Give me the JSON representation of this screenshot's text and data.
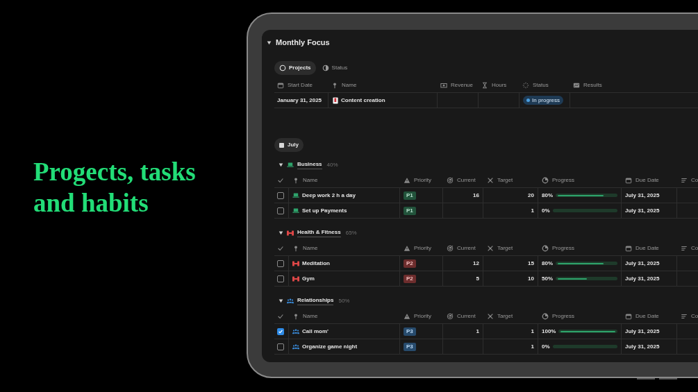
{
  "headline": "Progects, tasks and habits",
  "section": {
    "title": "Monthly Focus",
    "expanded": true
  },
  "views": [
    {
      "label": "Projects",
      "selected": true
    },
    {
      "label": "Status",
      "selected": false
    }
  ],
  "projects_table": {
    "columns": [
      "Start Date",
      "Name",
      "Revenue",
      "Hours",
      "Status",
      "Results"
    ],
    "rows": [
      {
        "start_date": "January 31, 2025",
        "name": "Content creation",
        "status": {
          "label": "In progress",
          "color": "#4a9fe0"
        }
      }
    ]
  },
  "month_tab": {
    "label": "July"
  },
  "groups": [
    {
      "title": "Business",
      "percent": "40%",
      "expanded": true,
      "kind": "work",
      "color": "#2ea36b",
      "columns": [
        "Name",
        "Priority",
        "Current",
        "Target",
        "Progress",
        "Due Date",
        "Co"
      ],
      "rows": [
        {
          "checked": false,
          "name": "Deep work 2 h a day",
          "priority": "P1",
          "current": "16",
          "target": "20",
          "progress": "80%",
          "level": 0.8,
          "due_date": "July 31, 2025"
        },
        {
          "checked": false,
          "name": "Set up Payments",
          "priority": "P1",
          "target": "1",
          "progress": "0%",
          "level": 0,
          "due_date": "July 31, 2025"
        }
      ]
    },
    {
      "title": "Health & Fitness",
      "percent": "65%",
      "expanded": true,
      "kind": "fitness",
      "color": "#e04848",
      "columns": [
        "Name",
        "Priority",
        "Current",
        "Target",
        "Progress",
        "Due Date",
        "Co"
      ],
      "rows": [
        {
          "checked": false,
          "name": "Meditation",
          "priority": "P2",
          "current": "12",
          "target": "15",
          "progress": "80%",
          "level": 0.8,
          "due_date": "July 31, 2025"
        },
        {
          "checked": false,
          "name": "Gym",
          "priority": "P2",
          "current": "5",
          "target": "10",
          "progress": "50%",
          "level": 0.5,
          "due_date": "July 31, 2025"
        }
      ]
    },
    {
      "title": "Relationships",
      "percent": "50%",
      "expanded": true,
      "kind": "people",
      "color": "#3b8fe0",
      "columns": [
        "Name",
        "Priority",
        "Current",
        "Target",
        "Progress",
        "Due Date",
        "Co"
      ],
      "rows": [
        {
          "checked": true,
          "name": "Call mom'",
          "priority": "P3",
          "current": "1",
          "target": "1",
          "progress": "100%",
          "level": 1,
          "due_date": "July 31, 2025"
        },
        {
          "checked": false,
          "name": "Organize game night",
          "priority": "P3",
          "target": "1",
          "progress": "0%",
          "level": 0,
          "due_date": "July 31, 2025"
        }
      ]
    }
  ]
}
